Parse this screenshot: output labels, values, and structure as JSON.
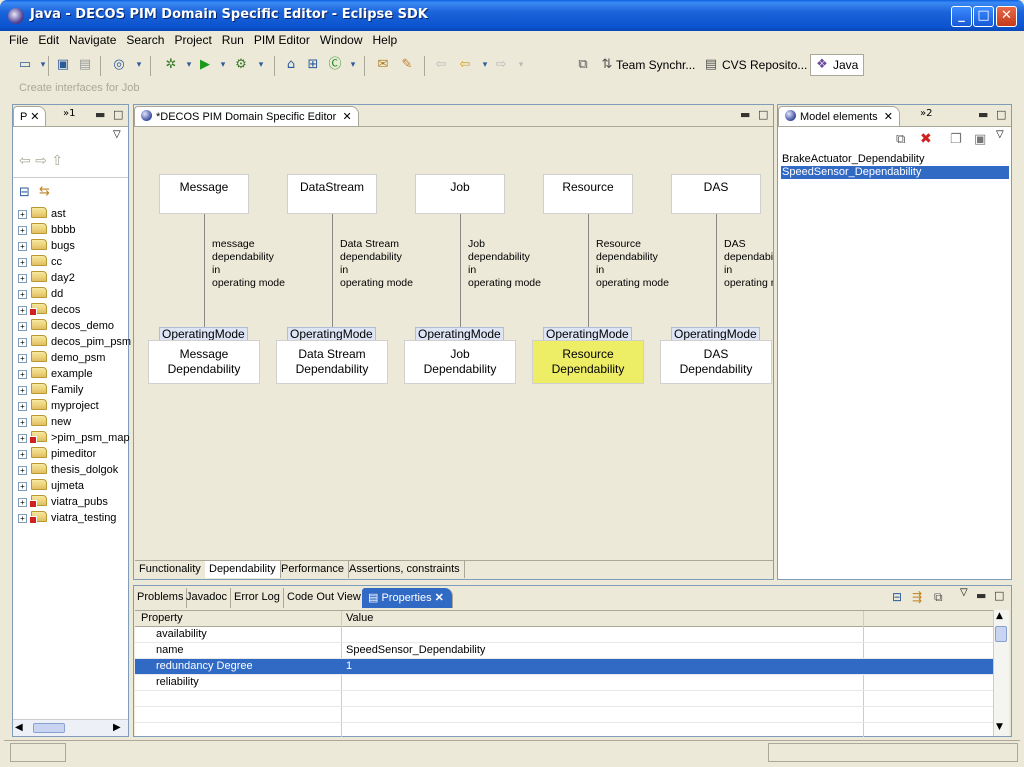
{
  "window": {
    "title": "Java - DECOS PIM Domain Specific Editor - Eclipse SDK",
    "buttons": [
      "_",
      "□",
      "✕"
    ]
  },
  "menu": [
    "File",
    "Edit",
    "Navigate",
    "Search",
    "Project",
    "Run",
    "PIM Editor",
    "Window",
    "Help"
  ],
  "toolbar": {
    "hint": "Create interfaces for Job",
    "perspectives": [
      "Team Synchr...",
      "CVS Reposito...",
      "Java"
    ]
  },
  "package_explorer": {
    "tab_label": "P",
    "tab2_label": "»1",
    "items": [
      {
        "label": "ast",
        "marker": false
      },
      {
        "label": "bbbb",
        "marker": false
      },
      {
        "label": "bugs",
        "marker": false
      },
      {
        "label": "cc",
        "marker": false
      },
      {
        "label": "day2",
        "marker": false
      },
      {
        "label": "dd",
        "marker": false
      },
      {
        "label": "decos",
        "marker": true
      },
      {
        "label": "decos_demo",
        "marker": false
      },
      {
        "label": "decos_pim_psm",
        "marker": false
      },
      {
        "label": "demo_psm",
        "marker": false
      },
      {
        "label": "example",
        "marker": false
      },
      {
        "label": "Family",
        "marker": false
      },
      {
        "label": "myproject",
        "marker": false
      },
      {
        "label": "new",
        "marker": false
      },
      {
        "label": ">pim_psm_map",
        "marker": true
      },
      {
        "label": "pimeditor",
        "marker": false
      },
      {
        "label": "thesis_dolgok",
        "marker": false
      },
      {
        "label": "ujmeta",
        "marker": false
      },
      {
        "label": "viatra_pubs",
        "marker": true
      },
      {
        "label": "viatra_testing",
        "marker": true
      }
    ]
  },
  "editor": {
    "tab_label": "*DECOS PIM Domain Specific Editor",
    "columns": [
      {
        "top": "Message",
        "relation": "message\ndependability\nin\noperating mode",
        "op": "OperatingMode",
        "dep": "Message\nDependability",
        "selected": false
      },
      {
        "top": "DataStream",
        "relation": "Data Stream\ndependability\nin\noperating mode",
        "op": "OperatingMode",
        "dep": "Data Stream\nDependability",
        "selected": false
      },
      {
        "top": "Job",
        "relation": "Job\ndependability\nin\noperating mode",
        "op": "OperatingMode",
        "dep": "Job\nDependability",
        "selected": false
      },
      {
        "top": "Resource",
        "relation": "Resource\ndependability\nin\noperating mode",
        "op": "OperatingMode",
        "dep": "Resource\nDependability",
        "selected": true
      },
      {
        "top": "DAS",
        "relation": "DAS\ndependabil\nin\noperating r",
        "op": "OperatingMode",
        "dep": "DAS\nDependability",
        "selected": false
      }
    ],
    "bottom_tabs": [
      "Functionality",
      "Dependability",
      "Performance",
      "Assertions, constraints"
    ],
    "active_bottom_tab": "Dependability"
  },
  "model_elements": {
    "tab_label": "Model elements",
    "tab2_label": "»2",
    "items": [
      {
        "label": "BrakeActuator_Dependability",
        "selected": false
      },
      {
        "label": "SpeedSensor_Dependability",
        "selected": true
      }
    ]
  },
  "bottom_panel": {
    "tabs": [
      "Problems",
      "Javadoc",
      "Error Log",
      "Code Out View",
      "Properties"
    ],
    "active_tab": "Properties",
    "columns": [
      "Property",
      "Value"
    ],
    "rows": [
      {
        "property": "availability",
        "value": "",
        "selected": false
      },
      {
        "property": "name",
        "value": "SpeedSensor_Dependability",
        "selected": false
      },
      {
        "property": "redundancy Degree",
        "value": "1",
        "selected": true
      },
      {
        "property": "reliability",
        "value": "",
        "selected": false
      }
    ]
  },
  "colors": {
    "titlebar": "#0c54cf",
    "selection": "#316ac5",
    "highlight_box": "#eeee66",
    "chrome": "#ece9d8"
  }
}
